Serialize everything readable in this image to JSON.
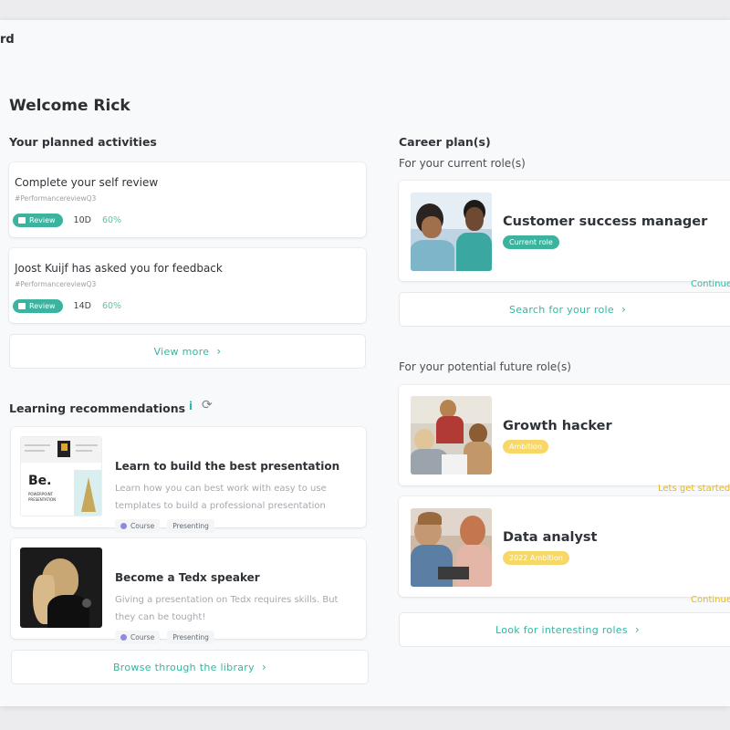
{
  "header": {
    "app_title": "rd",
    "welcome": "Welcome Rick"
  },
  "activities": {
    "title": "Your planned activities",
    "items": [
      {
        "title": "Complete your self review",
        "tag": "#PerformancereviewQ3",
        "badge": "Review",
        "days": "10D",
        "progress": "60%"
      },
      {
        "title": "Joost Kuijf has asked you for feedback",
        "tag": "#PerformancereviewQ3",
        "badge": "Review",
        "days": "14D",
        "progress": "60%"
      }
    ],
    "view_more": "View more"
  },
  "learning": {
    "title": "Learning recommendations",
    "info_icon": "i",
    "items": [
      {
        "title": "Learn to build the best presentation",
        "description": "Learn how you can best work with easy to use templates to build a professional presentation",
        "chips": [
          "Course",
          "Presenting"
        ],
        "thumb_text": "Be.",
        "thumb_sub": "POWERPOINT PRESENTATION"
      },
      {
        "title": "Become a Tedx speaker",
        "description": "Giving a presentation on Tedx requires skills. But they can be tought!",
        "chips": [
          "Course",
          "Presenting"
        ]
      }
    ],
    "browse": "Browse through the library"
  },
  "career": {
    "title": "Career plan(s)",
    "current_label": "For your current role(s)",
    "current": {
      "title": "Customer success manager",
      "pill": "Current role",
      "action": "Continue"
    },
    "search": "Search for your role",
    "future_label": "For your potential future role(s)",
    "future": [
      {
        "title": "Growth hacker",
        "pill": "Ambition",
        "action": "Lets get started"
      },
      {
        "title": "Data analyst",
        "pill": "2022 Ambition",
        "action": "Continue"
      }
    ],
    "look": "Look for interesting roles"
  },
  "colors": {
    "accent": "#3cb39f",
    "ambition": "#f7d766",
    "action_yellow": "#e5b918"
  }
}
